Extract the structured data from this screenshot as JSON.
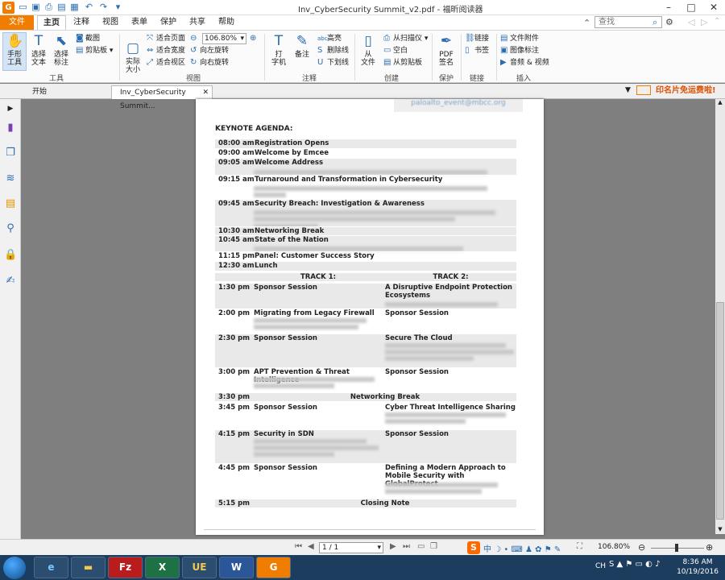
{
  "titlebar": {
    "title": "Inv_CyberSecurity Summit_v2.pdf - 福昕阅读器"
  },
  "menu": {
    "tabs": [
      "文件",
      "主页",
      "注释",
      "视图",
      "表单",
      "保护",
      "共享",
      "帮助"
    ]
  },
  "search": {
    "placeholder": "查找"
  },
  "ribbon": {
    "hand": "手形\n工具",
    "select_text": "选择\n文本",
    "select_ann": "选择\n标注",
    "screenshot": "截图",
    "clipboard": "剪贴板",
    "group_tools": "工具",
    "actual_size": "实际\n大小",
    "fit_page": "适合页面",
    "fit_width": "适合宽度",
    "fit_view": "适合视区",
    "zoom_value": "106.80%",
    "rotate_left": "向左旋转",
    "rotate_right": "向右旋转",
    "group_view": "视图",
    "typewriter": "打\n字机",
    "note": "备注",
    "highlight": "高亮",
    "strikeout": "删除线",
    "underline": "下划线",
    "group_comment": "注释",
    "from_file": "从\n文件",
    "from_scanner": "从扫描仪",
    "blank": "空白",
    "from_clipboard": "从剪贴板",
    "group_create": "创建",
    "pdf_sign": "PDF\n签名",
    "group_protect": "保护",
    "link": "链接",
    "bookmark": "书签",
    "group_link": "链接",
    "file_attach": "文件附件",
    "image_ann": "图像标注",
    "audio_video": "音频 & 视频",
    "group_insert": "插入"
  },
  "doctabs": {
    "start": "开始",
    "doc": "Inv_CyberSecurity Summit..."
  },
  "ad": {
    "text": "印名片免运费啦!"
  },
  "page": {
    "email": "paloalto_event@mbcc.org",
    "keynote_title": "KEYNOTE AGENDA:",
    "keynote": [
      {
        "time": "08:00 am",
        "title": "Registration Opens"
      },
      {
        "time": "09:00 am",
        "title": "Welcome by Emcee"
      },
      {
        "time": "09:05 am",
        "title": "Welcome Address"
      },
      {
        "time": "09:15 am",
        "title": "Turnaround and Transformation in Cybersecurity"
      },
      {
        "time": "09:45 am",
        "title": "Security Breach: Investigation & Awareness"
      },
      {
        "time": "10:30 am",
        "title": "Networking Break"
      },
      {
        "time": "10:45 am",
        "title": "State of the Nation"
      },
      {
        "time": "11:15 pm",
        "title": "Panel: Customer Success Story"
      },
      {
        "time": "12:30 am",
        "title": "Lunch"
      }
    ],
    "track1": "TRACK 1:",
    "track2": "TRACK 2:",
    "tracks": [
      {
        "time": "1:30 pm",
        "t1": "Sponsor Session",
        "t2": "A Disruptive Endpoint Protection Ecosystems"
      },
      {
        "time": "2:00 pm",
        "t1": "Migrating from Legacy Firewall",
        "t2": "Sponsor Session"
      },
      {
        "time": "2:30 pm",
        "t1": "Sponsor Session",
        "t2": "Secure The Cloud"
      },
      {
        "time": "3:00 pm",
        "t1": "APT Prevention & Threat Intelligence",
        "t2": "Sponsor Session"
      },
      {
        "time": "3:30 pm",
        "break": "Networking Break"
      },
      {
        "time": "3:45 pm",
        "t1": "Sponsor Session",
        "t2": "Cyber Threat Intelligence Sharing"
      },
      {
        "time": "4:15 pm",
        "t1": "Security in SDN",
        "t2": "Sponsor Session"
      },
      {
        "time": "4:45 pm",
        "t1": "Sponsor Session",
        "t2": "Defining a Modern Approach to Mobile Security with GlobalProtect"
      },
      {
        "time": "5:15 pm",
        "break": "Closing Note"
      }
    ]
  },
  "status": {
    "page": "1 / 1",
    "zoom": "106.80%"
  },
  "taskbar": {
    "lang": "CH",
    "time": "8:36 AM",
    "date": "10/19/2016"
  }
}
